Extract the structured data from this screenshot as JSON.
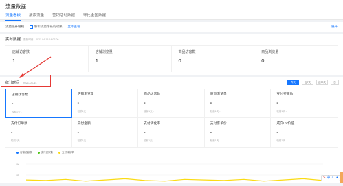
{
  "page": {
    "title": "流量数据"
  },
  "tabs": [
    {
      "label": "流量看板",
      "active": true
    },
    {
      "label": "搜索流量",
      "active": false
    },
    {
      "label": "营销活动数据",
      "active": false
    },
    {
      "label": "环比全国数据",
      "active": false
    }
  ],
  "toolbar": {
    "label": "流量提升秘籍",
    "check_text": "解析流量增长的效果",
    "link": "立即查看",
    "right": "展开"
  },
  "realtime": {
    "title": "实时数据",
    "subtitle": "更新时间：2021-04-15 14:07:00",
    "cells": [
      {
        "label": "店铺访客数",
        "value": "1"
      },
      {
        "label": "店铺浏览量",
        "value": "1"
      },
      {
        "label": "商品访客数",
        "value": "0"
      },
      {
        "label": "商品浏览量",
        "value": "0"
      }
    ]
  },
  "stats": {
    "title": "统计时间",
    "date": "2021-04-14",
    "range_buttons": [
      {
        "label": "昨天",
        "active": true
      },
      {
        "label": "近7天",
        "active": false
      },
      {
        "label": "近30天",
        "active": false
      },
      {
        "label": "日",
        "active": false
      }
    ],
    "metrics": [
      {
        "label": "店铺访客数",
        "value": "-",
        "compare": "较前1天 -"
      },
      {
        "label": "店铺浏览量",
        "value": "-",
        "compare": "较前1天 -"
      },
      {
        "label": "商品访客数",
        "value": "-",
        "compare": "较前1天 -"
      },
      {
        "label": "商品浏览量",
        "value": "-",
        "compare": "较前1天 -"
      },
      {
        "label": "支付买家数",
        "value": "-",
        "compare": "较前1天 -"
      },
      {
        "label": "支付订单数",
        "value": "-",
        "compare": "较前1天 -"
      },
      {
        "label": "支付金额",
        "value": "-",
        "compare": "较前1天 -"
      },
      {
        "label": "支付转化率",
        "value": "-",
        "compare": "较前1天 -"
      },
      {
        "label": "支付客单价",
        "value": "-",
        "compare": "较前1天 -"
      },
      {
        "label": "成交UV价值",
        "value": "-",
        "compare": "较前1天 -"
      }
    ]
  },
  "chart_data": {
    "type": "line",
    "series": [
      {
        "name": "店铺访客数",
        "color": "#1677ff"
      },
      {
        "name": "支付买家数",
        "color": "#52c41a"
      },
      {
        "name": "支付转化率",
        "color": "#fadb14"
      }
    ],
    "yticks": [
      "12",
      "10"
    ],
    "line_color": "#fadb14",
    "y_values": [
      9.2,
      9.1,
      9.3,
      9.0,
      9.2,
      9.4,
      9.1,
      9.0,
      9.3,
      9.2,
      9.1,
      9.3,
      9.0,
      9.2,
      9.4,
      9.1
    ],
    "ylim": [
      8,
      12
    ]
  }
}
